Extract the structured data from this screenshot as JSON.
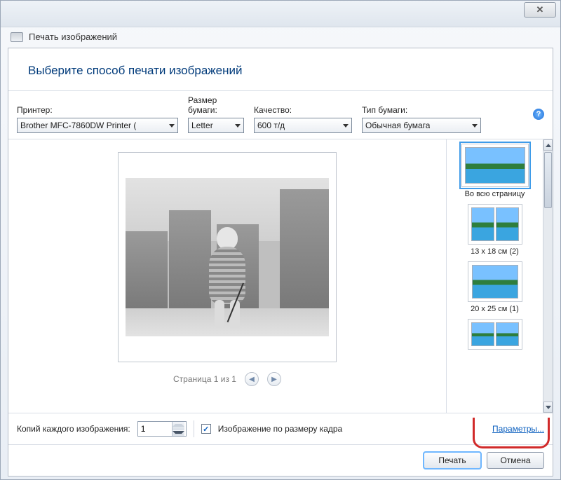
{
  "window": {
    "title": "Печать изображений",
    "instruction": "Выберите способ печати изображений"
  },
  "labels": {
    "printer": "Принтер:",
    "paper_size": "Размер бумаги:",
    "quality": "Качество:",
    "paper_type": "Тип бумаги:"
  },
  "values": {
    "printer": "Brother MFC-7860DW Printer (",
    "paper_size": "Letter",
    "quality": "600 т/д",
    "paper_type": "Обычная бумага"
  },
  "pager": {
    "text": "Страница 1 из 1"
  },
  "layouts": {
    "full_page": "Во всю страницу",
    "l13x18": "13 x 18 см (2)",
    "l20x25": "20 x 25 см (1)"
  },
  "footer": {
    "copies_label": "Копий каждого изображения:",
    "copies_value": "1",
    "fit_checkbox": "Изображение по размеру кадра",
    "options_link": "Параметры..."
  },
  "buttons": {
    "print": "Печать",
    "cancel": "Отмена"
  }
}
